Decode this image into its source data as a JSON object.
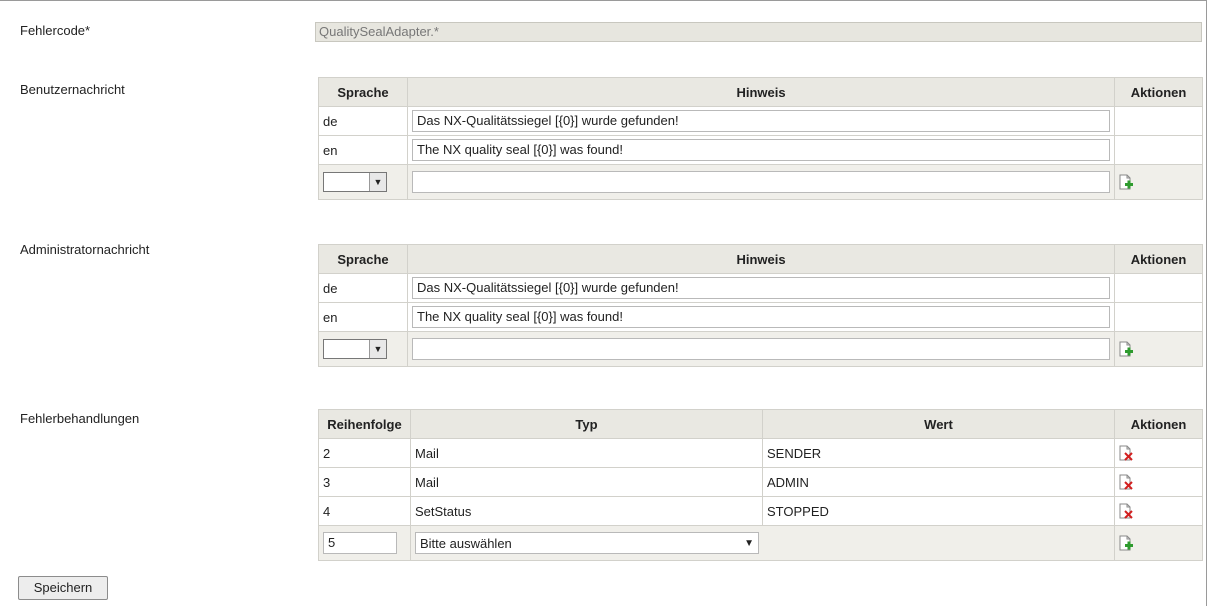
{
  "fields": {
    "fehlercode": {
      "label": "Fehlercode*",
      "value": "QualitySealAdapter.*"
    },
    "benutzer": {
      "label": "Benutzernachricht"
    },
    "admin": {
      "label": "Administratornachricht"
    },
    "behandlungen": {
      "label": "Fehlerbehandlungen"
    }
  },
  "message_table": {
    "headers": {
      "lang": "Sprache",
      "hint": "Hinweis",
      "actions": "Aktionen"
    }
  },
  "benutzer_rows": [
    {
      "lang": "de",
      "hint": "Das NX-Qualitätssiegel [{0}] wurde gefunden!"
    },
    {
      "lang": "en",
      "hint": "The NX quality seal [{0}] was found!"
    }
  ],
  "admin_rows": [
    {
      "lang": "de",
      "hint": "Das NX-Qualitätssiegel [{0}] wurde gefunden!"
    },
    {
      "lang": "en",
      "hint": "The NX quality seal [{0}] was found!"
    }
  ],
  "handling_table": {
    "headers": {
      "order": "Reihenfolge",
      "type": "Typ",
      "value": "Wert",
      "actions": "Aktionen"
    },
    "rows": [
      {
        "order": "2",
        "type": "Mail",
        "value": "SENDER"
      },
      {
        "order": "3",
        "type": "Mail",
        "value": "ADMIN"
      },
      {
        "order": "4",
        "type": "SetStatus",
        "value": "STOPPED"
      }
    ],
    "new_order": "5",
    "new_type_placeholder": "Bitte auswählen"
  },
  "buttons": {
    "save": "Speichern"
  },
  "icons": {
    "add": "add-document-icon",
    "delete": "delete-document-icon",
    "dropdown": "chevron-down-icon"
  }
}
